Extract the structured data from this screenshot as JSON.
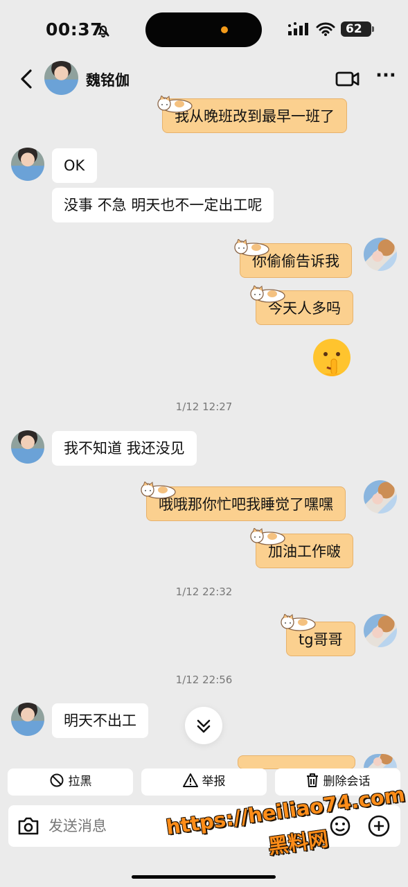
{
  "status": {
    "time": "00:37",
    "battery": "62"
  },
  "header": {
    "contact_name": "魏铭伽"
  },
  "messages": [
    {
      "text": "我从晚班改到最早一班了"
    },
    {
      "text": "OK"
    },
    {
      "text": "没事 不急 明天也不一定出工呢"
    },
    {
      "text": "你偷偷告诉我"
    },
    {
      "text": "今天人多吗"
    },
    {
      "text": "我不知道 我还没见"
    },
    {
      "text": "哦哦那你忙吧我睡觉了嘿嘿"
    },
    {
      "text": "加油工作啵"
    },
    {
      "text": "tg哥哥"
    },
    {
      "text": "明天不出工"
    }
  ],
  "timestamps": [
    "1/12 12:27",
    "1/12 22:32",
    "1/12 22:56"
  ],
  "actions": {
    "block": "拉黑",
    "report": "举报",
    "delete": "删除会话"
  },
  "composer": {
    "placeholder": "发送消息"
  },
  "watermark": {
    "line1": "https://heiliao74.com",
    "line2": "黑料网"
  },
  "icons": [
    "bell-muted-icon",
    "signal-icon",
    "wifi-icon",
    "battery-icon",
    "back-icon",
    "video-icon",
    "more-icon",
    "cat-sticker-icon",
    "shushing-face-icon",
    "chevron-double-down-icon",
    "block-icon",
    "warning-icon",
    "trash-icon",
    "camera-icon",
    "emoji-icon",
    "plus-icon"
  ],
  "colors": {
    "background": "#ebebeb",
    "incoming": "#ffffff",
    "outgoing": "#fbd08f",
    "watermark": "#ff8d19"
  }
}
